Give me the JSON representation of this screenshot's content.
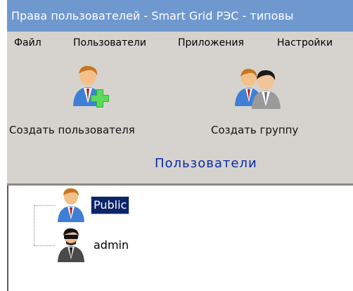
{
  "window": {
    "title": "Права пользователей - Smart Grid РЭС - типовы"
  },
  "menu": [
    {
      "label": "Файл"
    },
    {
      "label": "Пользователи"
    },
    {
      "label": "Приложения"
    },
    {
      "label": "Настройки"
    }
  ],
  "ribbon": {
    "create_user_label": "Создать пользователя",
    "create_group_label": "Создать группу",
    "group_label": "Пользователи"
  },
  "tree": {
    "nodes": [
      {
        "label": "Public",
        "selected": true
      },
      {
        "label": "admin",
        "selected": false
      }
    ]
  },
  "colors": {
    "titlebar": "#6e98ce",
    "group_label": "#0a2aa8",
    "selection": "#0a246a"
  }
}
